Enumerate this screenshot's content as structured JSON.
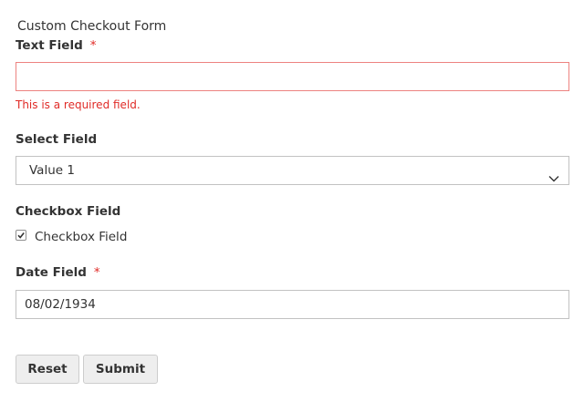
{
  "form": {
    "title": "Custom Checkout Form",
    "text_field": {
      "label": "Text Field",
      "required_mark": "*",
      "value": "",
      "error": "This is a required field."
    },
    "select_field": {
      "label": "Select Field",
      "selected": "Value 1"
    },
    "checkbox_field": {
      "label": "Checkbox Field",
      "option_label": "Checkbox Field",
      "checked": true
    },
    "date_field": {
      "label": "Date Field",
      "required_mark": "*",
      "value": "08/02/1934"
    },
    "buttons": {
      "reset": "Reset",
      "submit": "Submit"
    }
  },
  "colors": {
    "required": "#e02b27",
    "error_border": "#ed8380",
    "button_bg": "#eeeeee"
  },
  "icons": {
    "select_arrow": "chevron-down-icon",
    "checkbox_check": "checkmark-icon"
  }
}
